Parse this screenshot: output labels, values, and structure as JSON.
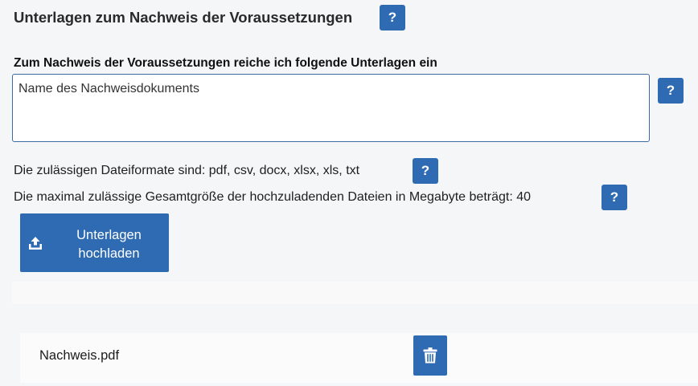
{
  "section": {
    "title": "Unterlagen zum Nachweis der Voraussetzungen",
    "help_label": "?"
  },
  "documents_field": {
    "label": "Zum Nachweis der Voraussetzungen reiche ich folgende Unterlagen ein",
    "placeholder": "Name des Nachweisdokuments",
    "value": "",
    "help_label": "?"
  },
  "formats": {
    "text": "Die zulässigen Dateiformate sind: pdf, csv, docx, xlsx, xls, txt",
    "help_label": "?"
  },
  "max_size": {
    "text": "Die maximal zulässige Gesamtgröße der hochzuladenden Dateien in Megabyte beträgt: 40",
    "help_label": "?"
  },
  "upload": {
    "label_line1": "Unterlagen",
    "label_line2": "hochladen",
    "icon": "upload-icon"
  },
  "uploaded_files": [
    {
      "name": "Nachweis.pdf",
      "delete_icon": "trash-icon"
    }
  ],
  "colors": {
    "accent": "#2f6bb2",
    "field_border": "#3d6aa5",
    "background": "#f5f6f7"
  }
}
